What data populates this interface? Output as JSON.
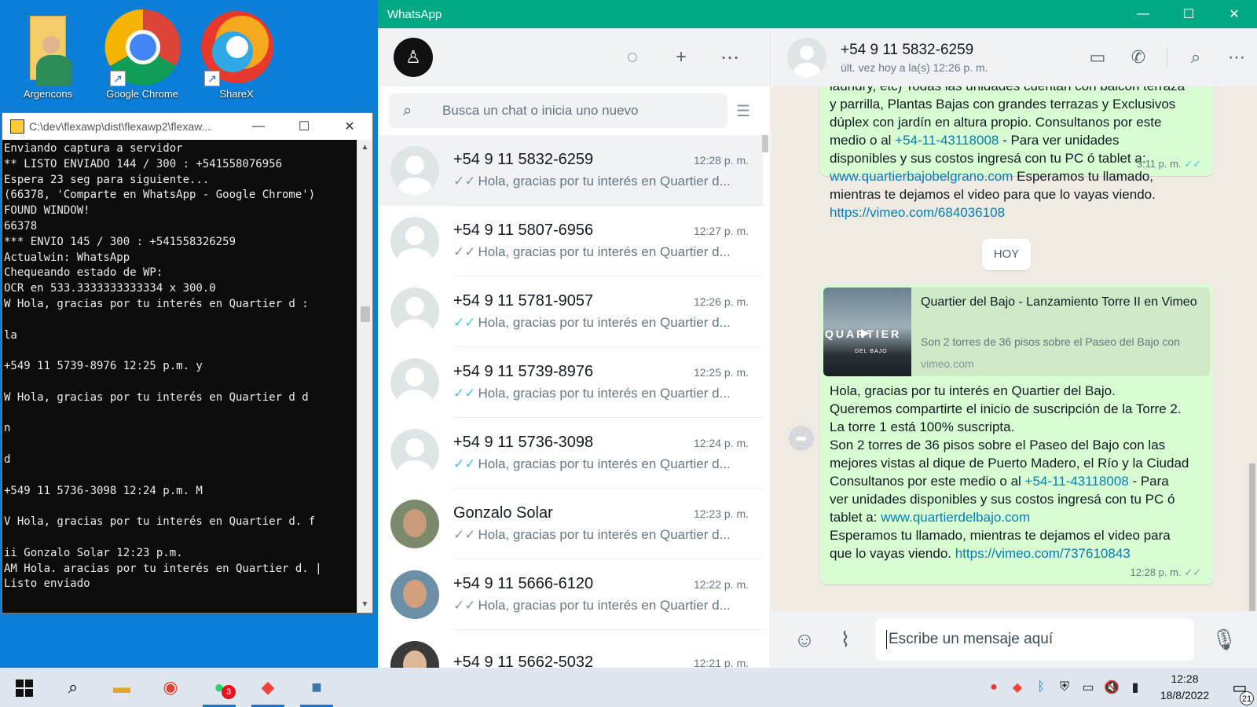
{
  "desktop": {
    "icons": [
      {
        "label": "Argencons"
      },
      {
        "label": "Google Chrome"
      },
      {
        "label": "ShareX"
      }
    ]
  },
  "console": {
    "title": "C:\\dev\\flexawp\\dist\\flexawp2\\flexaw...",
    "lines": "Enviando captura a servidor\n** LISTO ENVIADO 144 / 300 : +541558076956\nEspera 23 seg para siguiente...\n(66378, 'Comparte en WhatsApp - Google Chrome')\nFOUND WINDOW!\n66378\n*** ENVIO 145 / 300 : +541558326259\nActualwin: WhatsApp\nChequeando estado de WP:\nOCR en 533.3333333333334 x 300.0\nW Hola, gracias por tu interés en Quartier d :\n\nla\n\n+549 11 5739-8976 12:25 p.m. y\n\nW Hola, gracias por tu interés en Quartier d d\n\nn\n\nd\n\n+549 11 5736-3098 12:24 p.m. M\n\nV Hola, gracias por tu interés en Quartier d. f\n\nii Gonzalo Solar 12:23 p.m.\nAM Hola. aracias por tu interés en Quartier d. |\nListo enviado"
  },
  "whatsapp": {
    "window_title": "WhatsApp",
    "search_placeholder": "Busca un chat o inicia uno nuevo",
    "chats": [
      {
        "name": "+54 9 11 5832-6259",
        "time": "12:28 p. m.",
        "preview": "Hola, gracias por tu interés en Quartier d...",
        "read": false
      },
      {
        "name": "+54 9 11 5807-6956",
        "time": "12:27 p. m.",
        "preview": "Hola, gracias por tu interés en Quartier d...",
        "read": false
      },
      {
        "name": "+54 9 11 5781-9057",
        "time": "12:26 p. m.",
        "preview": "Hola, gracias por tu interés en Quartier d...",
        "read": true
      },
      {
        "name": "+54 9 11 5739-8976",
        "time": "12:25 p. m.",
        "preview": "Hola, gracias por tu interés en Quartier d...",
        "read": true
      },
      {
        "name": "+54 9 11 5736-3098",
        "time": "12:24 p. m.",
        "preview": "Hola, gracias por tu interés en Quartier d...",
        "read": true
      },
      {
        "name": "Gonzalo Solar",
        "time": "12:23 p. m.",
        "preview": "Hola, gracias por tu interés en Quartier d...",
        "read": false
      },
      {
        "name": "+54 9 11 5666-6120",
        "time": "12:22 p. m.",
        "preview": "Hola, gracias por tu interés en Quartier d...",
        "read": false
      },
      {
        "name": "+54 9 11 5662-5032",
        "time": "12:21 p. m.",
        "preview": "",
        "read": false
      }
    ],
    "conversation": {
      "contact_name": "+54 9 11 5832-6259",
      "contact_status": "últ. vez hoy a la(s) 12:26 p. m.",
      "msg1": {
        "l1": "laundry, etc) Todas las unidades cuentan con balcón terraza",
        "l2": "y parrilla, Plantas Bajas con grandes terrazas y Exclusivos",
        "l3": "dúplex con jardín en altura propio. Consultanos por este",
        "l4a": "medio o al ",
        "phone": "+54-11-43118008",
        "l4b": " - Para ver unidades",
        "l5": "disponibles y sus costos ingresá con tu PC ó tablet a:",
        "site": "www.quartierbajobelgrano.com",
        "l6b": "  Esperamos tu llamado,",
        "l7": "mientras te dejamos el video para que lo vayas viendo.",
        "video": "https://vimeo.com/684036108",
        "time": "3:11 p. m."
      },
      "day_label": "HOY",
      "msg2": {
        "preview_title": "Quartier del Bajo - Lanzamiento Torre II en Vimeo",
        "preview_desc": "Son 2 torres de 36 pisos sobre el Paseo del Bajo con",
        "preview_domain": "vimeo.com",
        "thumb_text": "QUARTIER",
        "thumb_sub": "DEL BAJO",
        "l1": "Hola, gracias por tu interés en Quartier del Bajo.",
        "l2": "Queremos compartirte el inicio de suscripción de la Torre 2.",
        "l3": "La torre 1 está 100% suscripta.",
        "l4": "Son 2 torres de 36 pisos sobre el Paseo del Bajo con las",
        "l5": "mejores vistas al dique de Puerto Madero, el Río y la Ciudad",
        "l6a": "Consultanos por este medio o al ",
        "phone": "+54-11-43118008",
        "l6b": " - Para",
        "l7": "ver unidades disponibles y sus costos ingresá con tu PC ó",
        "l8a": "tablet a: ",
        "site": "www.quartierdelbajo.com",
        "l9": "Esperamos tu llamado, mientras te dejamos el video para",
        "l10a": "que lo vayas viendo. ",
        "video": "https://vimeo.com/737610843",
        "time": "12:28 p. m."
      },
      "compose_placeholder": "Escribe un mensaje aquí"
    }
  },
  "taskbar": {
    "whatsapp_badge": "3",
    "clock_time": "12:28",
    "clock_date": "18/8/2022",
    "notifications": "21"
  },
  "colors": {
    "whatsapp_green": "#00a884",
    "bubble_out": "#d9fdd3",
    "read_tick": "#53bdeb",
    "link": "#027eb5"
  }
}
